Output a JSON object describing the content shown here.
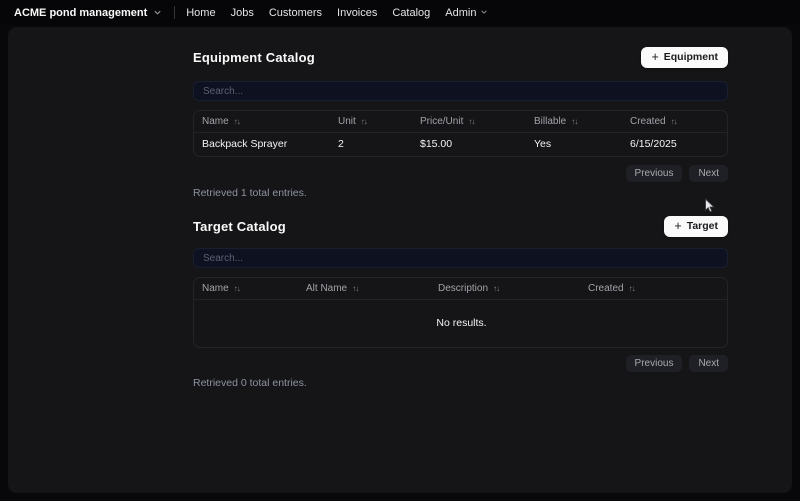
{
  "nav": {
    "brand": "ACME pond management",
    "items": [
      "Home",
      "Jobs",
      "Customers",
      "Invoices",
      "Catalog",
      "Admin"
    ]
  },
  "equipment": {
    "title": "Equipment Catalog",
    "add_label": "Equipment",
    "search_placeholder": "Search...",
    "columns": [
      "Name",
      "Unit",
      "Price/Unit",
      "Billable",
      "Created"
    ],
    "rows": [
      [
        "Backpack Sprayer",
        "2",
        "$15.00",
        "Yes",
        "6/15/2025"
      ]
    ],
    "previous": "Previous",
    "next": "Next",
    "summary": "Retrieved 1 total entries."
  },
  "target": {
    "title": "Target Catalog",
    "add_label": "Target",
    "search_placeholder": "Search...",
    "columns": [
      "Name",
      "Alt Name",
      "Description",
      "Created"
    ],
    "empty_text": "No results.",
    "previous": "Previous",
    "next": "Next",
    "summary": "Retrieved 0 total entries."
  },
  "colors": {
    "page_bg": "#060608",
    "card_bg": "#151517",
    "input_bg": "#0d1120",
    "primary_button_bg": "#fafafa",
    "secondary_button_bg": "#1f2025",
    "table_border": "#242428",
    "muted_text": "#a2a2ab"
  }
}
